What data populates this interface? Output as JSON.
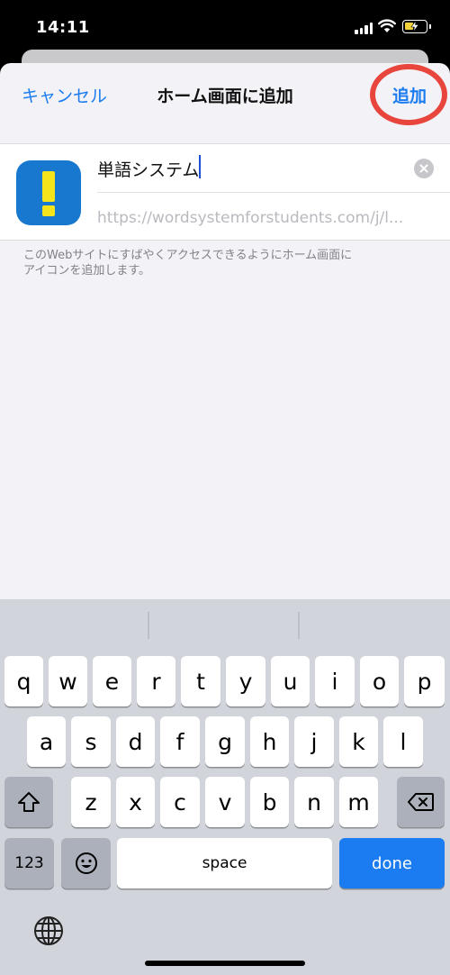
{
  "status_bar": {
    "time": "14:11",
    "icons": [
      "signal-icon",
      "wifi-icon",
      "battery-charging-icon"
    ],
    "battery_color": "#f2d13a"
  },
  "nav": {
    "cancel_label": "キャンセル",
    "title": "ホーム画面に追加",
    "add_label": "追加"
  },
  "form": {
    "app_icon": "exclamation-app-icon",
    "name_value": "単語システム",
    "url_value": "https://wordsystemforstudents.com/j/l...",
    "clear_icon": "clear-circle-icon"
  },
  "footnote": {
    "line1": "このWebサイトにすばやくアクセスできるようにホーム画面に",
    "line2": "アイコンを追加します。"
  },
  "keyboard": {
    "row1": [
      "q",
      "w",
      "e",
      "r",
      "t",
      "y",
      "u",
      "i",
      "o",
      "p"
    ],
    "row2": [
      "a",
      "s",
      "d",
      "f",
      "g",
      "h",
      "j",
      "k",
      "l"
    ],
    "row3": [
      "z",
      "x",
      "c",
      "v",
      "b",
      "n",
      "m"
    ],
    "numbers_label": "123",
    "space_label": "space",
    "done_label": "done",
    "icons": [
      "shift-icon",
      "backspace-icon",
      "emoji-icon",
      "globe-icon"
    ]
  },
  "colors": {
    "accent": "#1a7cf0",
    "annotation": "#e8453c",
    "icon_bg": "#1877cf",
    "icon_mark": "#f4e41b"
  }
}
